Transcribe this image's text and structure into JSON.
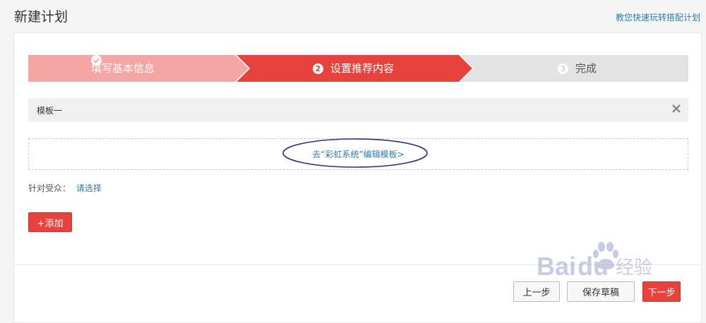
{
  "header": {
    "title": "新建计划",
    "help_link": "教您快速玩转搭配计划"
  },
  "stepper": {
    "steps": [
      {
        "number": "✓",
        "label": "填写基本信息",
        "state": "done"
      },
      {
        "number": "2",
        "label": "设置推荐内容",
        "state": "active"
      },
      {
        "number": "3",
        "label": "完成",
        "state": "pending"
      }
    ]
  },
  "template": {
    "name": "模板一",
    "edit_link": "去“彩虹系统”编辑模板>"
  },
  "audience": {
    "label": "针对受众：",
    "select_link": "请选择"
  },
  "actions": {
    "add_label": "+添加",
    "prev_label": "上一步",
    "save_draft_label": "保存草稿",
    "next_label": "下一步"
  },
  "watermark": {
    "text": "Baidu经验"
  },
  "colors": {
    "active_step": "#e8423e",
    "done_step": "#f5a6a4",
    "pending_step": "#e3e3e3",
    "link": "#2d7cb5",
    "primary_button": "#e8423e"
  }
}
